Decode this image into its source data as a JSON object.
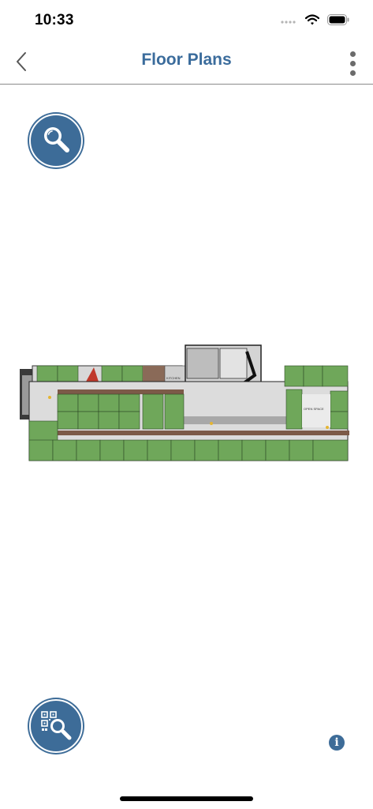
{
  "status": {
    "time": "10:33"
  },
  "nav": {
    "title": "Floor Plans",
    "back_icon": "chevron-left-icon",
    "menu_icon": "more-vertical-icon"
  },
  "buttons": {
    "search_icon": "magnifier-icon",
    "qr_search_icon": "qr-magnifier-icon",
    "info_icon": "info-icon",
    "info_glyph": "i"
  },
  "floor_plan": {
    "labels": {
      "common_space": "COMMON SPACE",
      "kitchen": "KITCHEN",
      "elevator_lobby": "ELEVATOR LOBBY",
      "open_space": "OPEN SPACE"
    }
  },
  "colors": {
    "accent": "#3b6c9c",
    "button": "#3d6c98",
    "office": "#6fa75a"
  }
}
